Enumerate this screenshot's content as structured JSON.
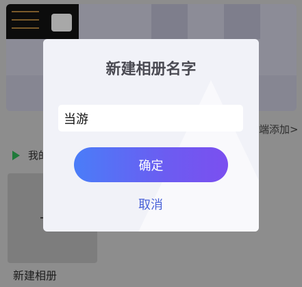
{
  "background": {
    "add_link": "端添加>",
    "section_label": "我的",
    "new_album_label": "新建相册"
  },
  "dialog": {
    "title": "新建相册名字",
    "input_value": "当游",
    "confirm_label": "确定",
    "cancel_label": "取消"
  },
  "colors": {
    "confirm_gradient_start": "#4a7df8",
    "confirm_gradient_end": "#7b4ff0",
    "cancel_text": "#4a62d8",
    "dialog_bg": "#f1f2f8"
  }
}
